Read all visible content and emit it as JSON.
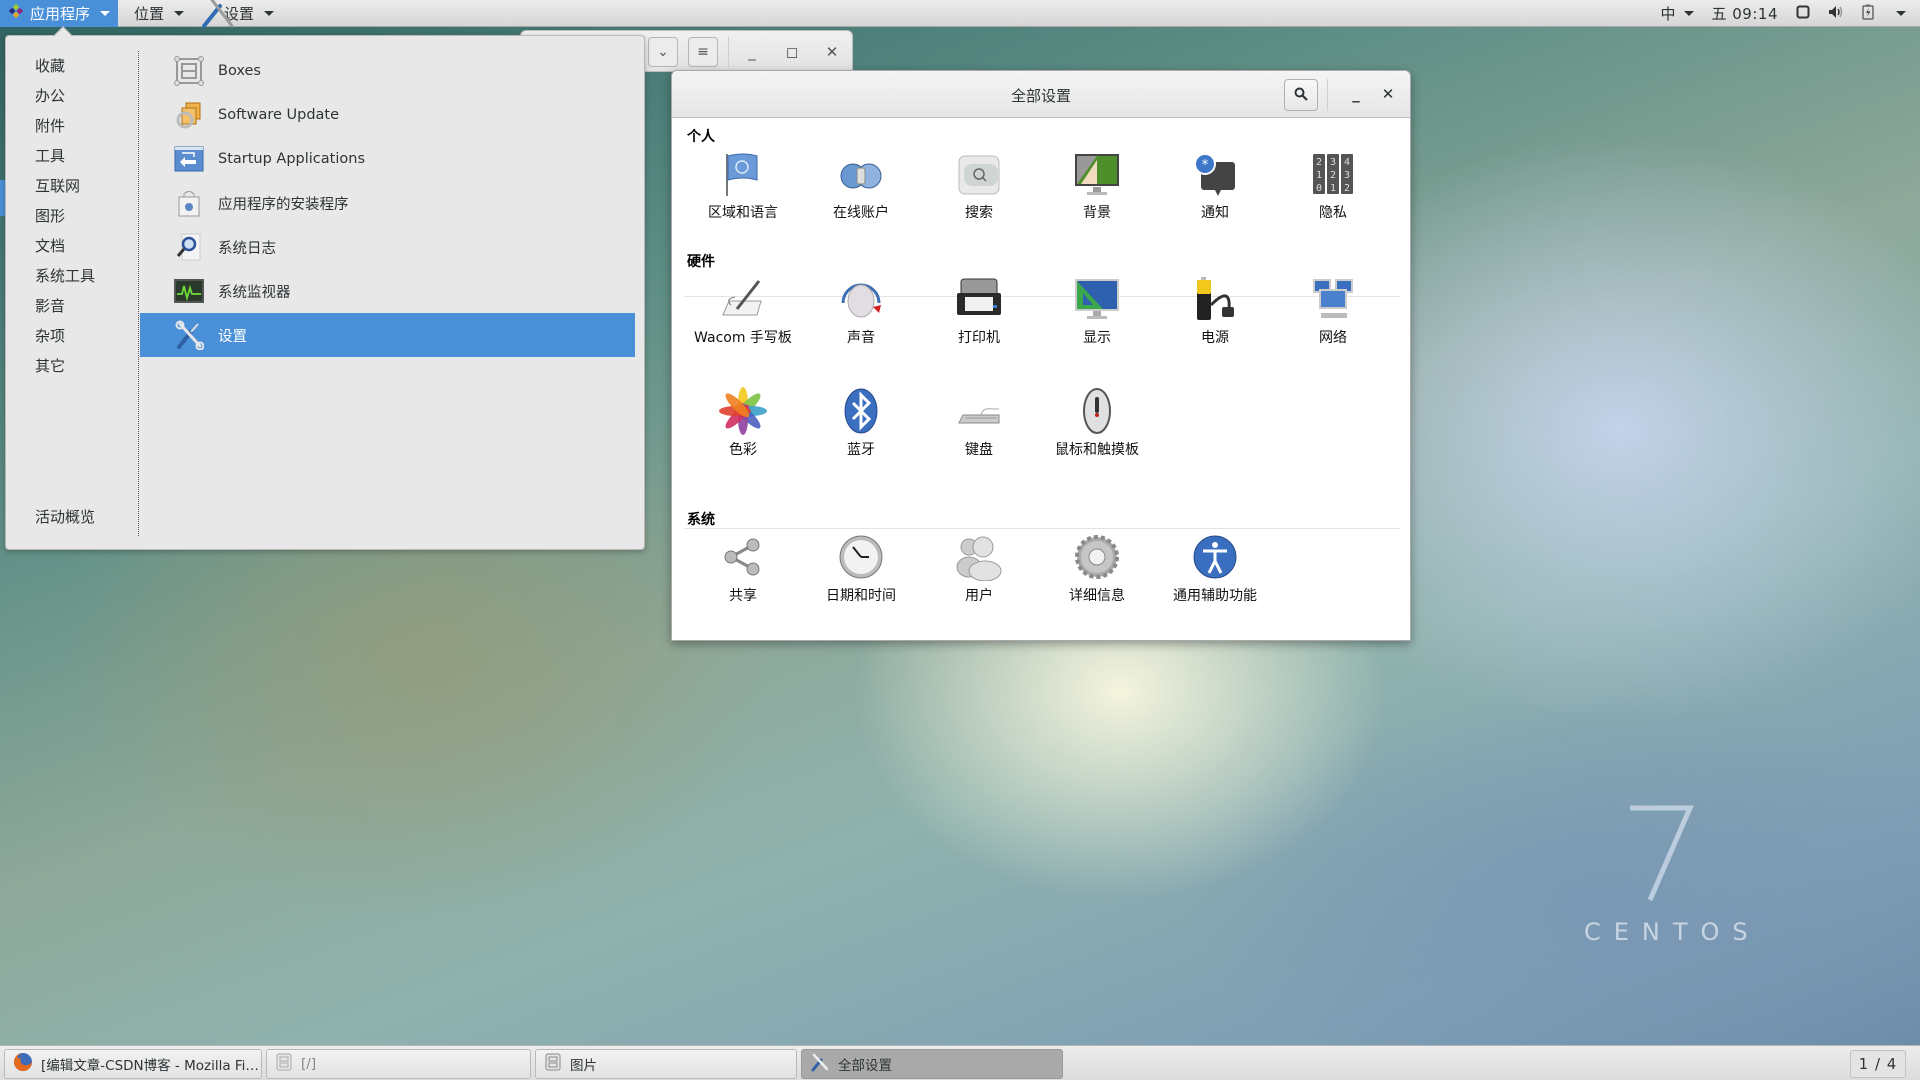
{
  "topbar": {
    "menus": [
      {
        "label": "应用程序",
        "active": true
      },
      {
        "label": "位置",
        "active": false
      },
      {
        "label": "设置",
        "active": false
      }
    ],
    "input_method": "中",
    "clock": "五 09:14"
  },
  "app_menu": {
    "categories": [
      "收藏",
      "办公",
      "附件",
      "工具",
      "互联网",
      "图形",
      "文档",
      "系统工具",
      "影音",
      "杂项",
      "其它"
    ],
    "overview_label": "活动概览",
    "apps": [
      {
        "label": "Boxes",
        "icon": "boxes-icon",
        "selected": false
      },
      {
        "label": "Software Update",
        "icon": "software-update-icon",
        "selected": false
      },
      {
        "label": "Startup Applications",
        "icon": "startup-applications-icon",
        "selected": false
      },
      {
        "label": "应用程序的安装程序",
        "icon": "software-installer-icon",
        "selected": false
      },
      {
        "label": "系统日志",
        "icon": "system-log-icon",
        "selected": false
      },
      {
        "label": "系统监视器",
        "icon": "system-monitor-icon",
        "selected": false
      },
      {
        "label": "设置",
        "icon": "settings-icon",
        "selected": true
      }
    ]
  },
  "settings_window": {
    "title": "全部设置",
    "sections": [
      {
        "title": "个人",
        "items": [
          {
            "label": "区域和语言",
            "icon": "region-language-icon"
          },
          {
            "label": "在线账户",
            "icon": "online-accounts-icon"
          },
          {
            "label": "搜索",
            "icon": "search-settings-icon"
          },
          {
            "label": "背景",
            "icon": "background-icon"
          },
          {
            "label": "通知",
            "icon": "notifications-icon"
          },
          {
            "label": "隐私",
            "icon": "privacy-icon"
          }
        ]
      },
      {
        "title": "硬件",
        "items": [
          {
            "label": "Wacom 手写板",
            "icon": "wacom-tablet-icon"
          },
          {
            "label": "声音",
            "icon": "sound-icon"
          },
          {
            "label": "打印机",
            "icon": "printer-icon"
          },
          {
            "label": "显示",
            "icon": "display-icon"
          },
          {
            "label": "电源",
            "icon": "power-icon"
          },
          {
            "label": "网络",
            "icon": "network-icon"
          },
          {
            "label": "色彩",
            "icon": "color-icon"
          },
          {
            "label": "蓝牙",
            "icon": "bluetooth-icon"
          },
          {
            "label": "键盘",
            "icon": "keyboard-icon"
          },
          {
            "label": "鼠标和触摸板",
            "icon": "mouse-touchpad-icon"
          }
        ]
      },
      {
        "title": "系统",
        "items": [
          {
            "label": "共享",
            "icon": "sharing-icon"
          },
          {
            "label": "日期和时间",
            "icon": "date-time-icon"
          },
          {
            "label": "用户",
            "icon": "users-icon"
          },
          {
            "label": "详细信息",
            "icon": "details-icon"
          },
          {
            "label": "通用辅助功能",
            "icon": "accessibility-icon"
          }
        ]
      }
    ]
  },
  "desktop": {
    "logo_number": "7",
    "logo_text": "CENTOS"
  },
  "taskbar": {
    "tasks": [
      {
        "label": "[编辑文章-CSDN博客 - Mozilla Fi…",
        "icon": "firefox-icon",
        "state": "normal"
      },
      {
        "label": "[/]",
        "icon": "file-cabinet-icon",
        "state": "minimized"
      },
      {
        "label": "图片",
        "icon": "file-cabinet-icon",
        "state": "normal"
      },
      {
        "label": "全部设置",
        "icon": "settings-icon",
        "state": "active"
      }
    ],
    "workspace": "1 / 4"
  },
  "colors": {
    "accent": "#4a90d9",
    "menu_bg": "#e8e8e8",
    "window_bg": "#ffffff"
  }
}
